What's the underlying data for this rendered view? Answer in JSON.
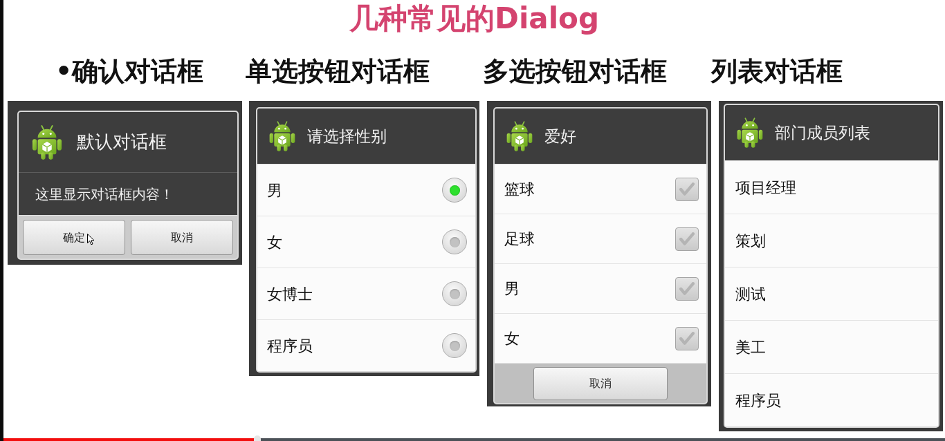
{
  "slide": {
    "title": "几种常见的Dialog",
    "headings": [
      "•确认对话框",
      "单选按钮对话框",
      "多选按钮对话框",
      "列表对话框"
    ]
  },
  "dialogs": [
    {
      "kind": "confirm",
      "title": "默认对话框",
      "message": "这里显示对话框内容！",
      "buttons": [
        "确定",
        "取消"
      ]
    },
    {
      "kind": "single_choice",
      "title": "请选择性别",
      "options": [
        {
          "label": "男",
          "selected": true
        },
        {
          "label": "女",
          "selected": false
        },
        {
          "label": "女博士",
          "selected": false
        },
        {
          "label": "程序员",
          "selected": false
        }
      ]
    },
    {
      "kind": "multi_choice",
      "title": "爱好",
      "options": [
        {
          "label": "篮球",
          "checked": false
        },
        {
          "label": "足球",
          "checked": false
        },
        {
          "label": "男",
          "checked": false
        },
        {
          "label": "女",
          "checked": false
        }
      ],
      "buttons": [
        "取消"
      ]
    },
    {
      "kind": "list",
      "title": "部门成员列表",
      "items": [
        "项目经理",
        "策划",
        "测试",
        "美工",
        "程序员"
      ]
    }
  ],
  "video_player": {
    "progress": {
      "level": 0.27
    }
  }
}
